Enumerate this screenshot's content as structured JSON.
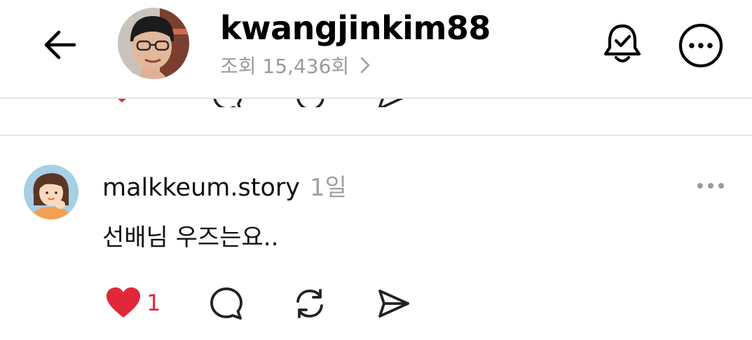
{
  "header": {
    "back_icon": "arrow-left-icon",
    "username": "kwangjinkim88",
    "view_count_label": "조회 15,436회",
    "view_count_chevron_icon": "chevron-right-icon",
    "notification_icon": "bell-check-icon",
    "more_icon": "more-horizontal-circle-icon"
  },
  "previous_post": {
    "actions": [
      "heart-icon",
      "comment-icon",
      "repost-icon",
      "send-icon"
    ]
  },
  "comment": {
    "username": "malkkeum.story",
    "time": "1일",
    "text": "선배님 우즈는요..",
    "more_icon": "more-horizontal-icon",
    "like_count": "1",
    "liked": true,
    "actions": [
      "heart-icon",
      "comment-icon",
      "repost-icon",
      "send-icon"
    ]
  },
  "colors": {
    "like": "#e0283a",
    "muted": "#9a9a9a",
    "divider": "#e4e4e4"
  }
}
